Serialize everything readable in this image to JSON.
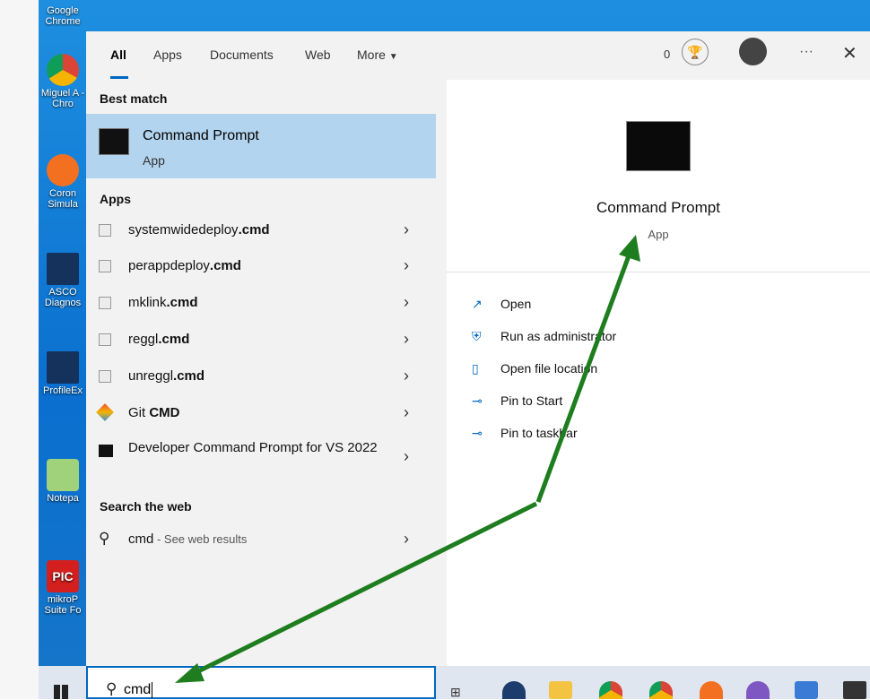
{
  "desktop": {
    "icons": [
      {
        "label": "Google Chrome"
      },
      {
        "label": "Miguel A - Chro"
      },
      {
        "label": "Coron Simula"
      },
      {
        "label": "ASCO Diagnos"
      },
      {
        "label": "ProfileEx"
      },
      {
        "label": "Notepa"
      },
      {
        "label": "mikroP Suite Fo"
      }
    ]
  },
  "search": {
    "tabs": [
      "All",
      "Apps",
      "Documents",
      "Web",
      "More"
    ],
    "reward_count": "0",
    "best_match_header": "Best match",
    "best_match": {
      "title": "Command Prompt",
      "subtitle": "App"
    },
    "apps_header": "Apps",
    "apps": [
      {
        "name": "systemwidedeploy",
        "bold": ".cmd"
      },
      {
        "name": "perappdeploy",
        "bold": ".cmd"
      },
      {
        "name": "mklink",
        "bold": ".cmd"
      },
      {
        "name": "reggl",
        "bold": ".cmd"
      },
      {
        "name": "unreggl",
        "bold": ".cmd"
      },
      {
        "name": "Git ",
        "bold": "CMD"
      },
      {
        "name": "Developer Command Prompt for VS 2022",
        "bold": ""
      }
    ],
    "web_header": "Search the web",
    "web_result": {
      "query": "cmd",
      "suffix": " - See web results"
    },
    "preview": {
      "title": "Command Prompt",
      "subtitle": "App"
    },
    "actions": [
      "Open",
      "Run as administrator",
      "Open file location",
      "Pin to Start",
      "Pin to taskbar"
    ],
    "query": "cmd"
  },
  "colors": {
    "accent": "#0067c0",
    "selected": "#b3d4ee",
    "arrow": "#1e7d1e"
  }
}
